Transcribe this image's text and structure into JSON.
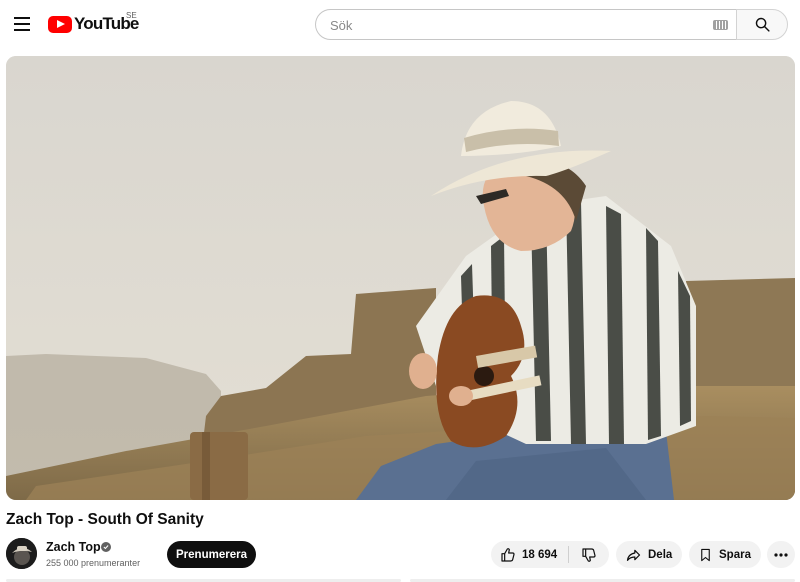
{
  "header": {
    "logo_text": "YouTube",
    "country_code": "SE",
    "search": {
      "placeholder": "Sök",
      "value": ""
    },
    "icons": [
      "menu-icon",
      "keyboard-icon",
      "search-icon"
    ]
  },
  "video": {
    "title": "Zach Top - South Of Sanity"
  },
  "channel": {
    "name": "Zach Top",
    "verified": true,
    "subscribers": "255 000 prenumeranter",
    "subscribe_label": "Prenumerera"
  },
  "actions": {
    "like_count": "18 694",
    "share_label": "Dela",
    "save_label": "Spara",
    "icons": [
      "thumb-up-icon",
      "thumb-down-icon",
      "share-icon",
      "bookmark-icon",
      "more-icon"
    ]
  },
  "colors": {
    "brand_red": "#ff0000",
    "subscribe_bg": "#0f0f0f",
    "pill_bg": "#f2f2f2"
  }
}
